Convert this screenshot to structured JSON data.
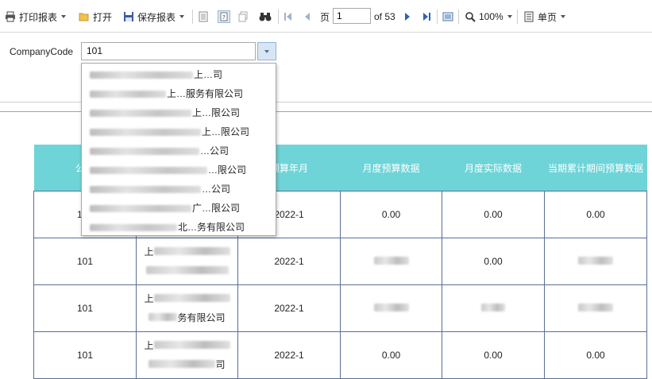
{
  "toolbar": {
    "print_label": "打印报表",
    "open_label": "打开",
    "save_label": "保存报表",
    "page_label": "页",
    "page_value": "1",
    "page_total": "of 53",
    "zoom_label": "100%",
    "single_page_label": "单页"
  },
  "params": {
    "label": "CompanyCode",
    "value": "101"
  },
  "dropdown": {
    "items": [
      "上…司",
      "上…服务有限公司",
      "上…限公司",
      "上…限公司",
      "…公司",
      "…限公司",
      "…公司",
      "广…限公司",
      "北…务有限公司"
    ]
  },
  "table": {
    "headers": [
      "公司",
      "",
      "预算年月",
      "月度预算数据",
      "月度实际数据",
      "当期累计期间预算数据"
    ],
    "rows": [
      {
        "company": "101",
        "name_line1": "",
        "name_line2": "",
        "month": "2022-1",
        "budget": "0.00",
        "actual": "0.00",
        "cum": "0.00"
      },
      {
        "company": "101",
        "name_line1": "上",
        "name_line2": "",
        "month": "2022-1",
        "budget": "",
        "actual": "0.00",
        "cum": ""
      },
      {
        "company": "101",
        "name_line1": "上",
        "name_line2": "务有限公司",
        "month": "2022-1",
        "budget": "",
        "actual": "",
        "cum": ""
      },
      {
        "company": "101",
        "name_line1": "上",
        "name_line2": "司",
        "month": "2022-1",
        "budget": "0.00",
        "actual": "0.00",
        "cum": "0.00"
      }
    ]
  }
}
